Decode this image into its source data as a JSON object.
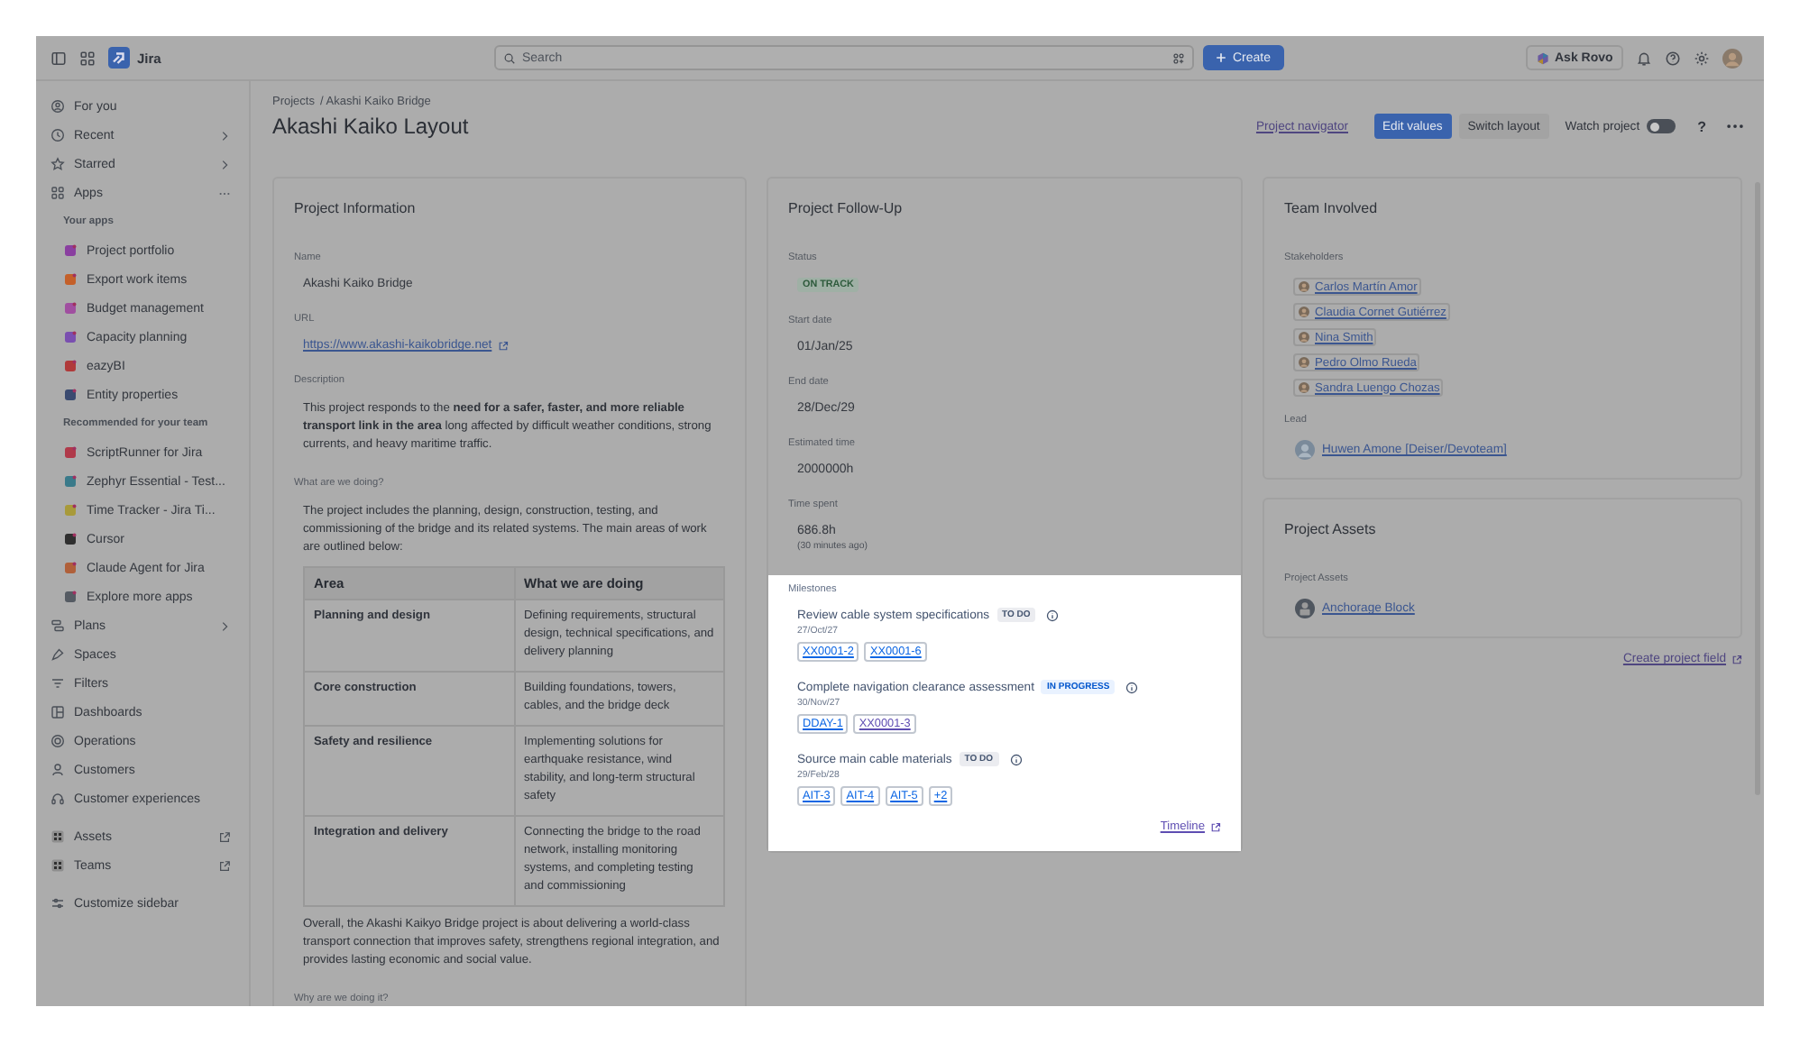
{
  "topbar": {
    "product": "Jira",
    "search": {
      "placeholder": "Search"
    },
    "create_button": "Create",
    "ask_rovo_button": "Ask Rovo"
  },
  "sidebar": {
    "sections": [
      {
        "items": [
          {
            "label": "For you",
            "kind": "nav"
          },
          {
            "label": "Recent",
            "kind": "menu"
          },
          {
            "label": "Starred",
            "kind": "menu"
          },
          {
            "label": "Apps",
            "kind": "group"
          },
          {
            "label": "Your apps",
            "kind": "heading"
          },
          {
            "label": "Project portfolio",
            "kind": "app"
          },
          {
            "label": "Export work items",
            "kind": "app"
          },
          {
            "label": "Budget management",
            "kind": "app"
          },
          {
            "label": "Capacity planning",
            "kind": "app"
          },
          {
            "label": "eazyBI",
            "kind": "app"
          },
          {
            "label": "Entity properties",
            "kind": "app"
          },
          {
            "label": "Recommended for your team",
            "kind": "heading"
          },
          {
            "label": "ScriptRunner for Jira",
            "kind": "app"
          },
          {
            "label": "Zephyr Essential - Test...",
            "kind": "app"
          },
          {
            "label": "Time Tracker - Jira Ti...",
            "kind": "app"
          },
          {
            "label": "Cursor",
            "kind": "app"
          },
          {
            "label": "Claude Agent for Jira",
            "kind": "app"
          },
          {
            "label": "Explore more apps",
            "kind": "app"
          },
          {
            "label": "Plans",
            "kind": "menu"
          },
          {
            "label": "Spaces",
            "kind": "nav"
          },
          {
            "label": "Filters",
            "kind": "nav"
          },
          {
            "label": "Dashboards",
            "kind": "nav"
          },
          {
            "label": "Operations",
            "kind": "nav"
          },
          {
            "label": "Customers",
            "kind": "nav"
          },
          {
            "label": "Customer experiences",
            "kind": "nav"
          }
        ]
      },
      {
        "items": [
          {
            "label": "Assets",
            "kind": "external"
          },
          {
            "label": "Teams",
            "kind": "external"
          }
        ]
      },
      {
        "items": [
          {
            "label": "Customize sidebar",
            "kind": "nav"
          }
        ]
      }
    ]
  },
  "breadcrumbs": [
    "Projects",
    "/ Akashi Kaiko Bridge"
  ],
  "page_title": "Akashi Kaiko Layout",
  "actions": {
    "project_navigator": "Project navigator",
    "edit_values": "Edit values",
    "switch_layout": "Switch layout",
    "watch_project": {
      "label": "Watch project",
      "on": false
    },
    "help": "?"
  },
  "project_information": {
    "title": "Project Information",
    "fields": [
      {
        "label": "Name",
        "kind": "text",
        "value": "Akashi Kaiko Bridge"
      },
      {
        "label": "URL",
        "kind": "link",
        "value": "https://www.akashi-kaikobridge.net"
      },
      {
        "label": "Description",
        "kind": "content",
        "blocks": [
          {
            "kind": "paragraph",
            "text": "This project responds to the **need for a safer, faster, and more reliable transport link in the area** long affected by difficult weather conditions, strong currents, and heavy maritime traffic."
          }
        ]
      },
      {
        "label": "What are we doing?",
        "kind": "content",
        "blocks": [
          {
            "kind": "paragraph",
            "text": "The project includes the planning, design, construction, testing, and commissioning of the bridge and its related systems. The main areas of work are outlined below:"
          },
          {
            "kind": "table",
            "columns": [
              "Area",
              "What we are doing"
            ],
            "rows": [
              [
                "Planning and design",
                "Defining requirements, structural design, technical specifications, and delivery planning"
              ],
              [
                "Core construction",
                "Building foundations, towers, cables, and the bridge deck"
              ],
              [
                "Safety and resilience",
                "Implementing solutions for earthquake resistance, wind stability, and long-term structural safety"
              ],
              [
                "Integration and delivery",
                "Connecting the bridge to the road network, installing monitoring systems, and completing testing and commissioning"
              ]
            ]
          },
          {
            "kind": "paragraph",
            "text": "Overall, the Akashi Kaikyo Bridge project is about delivering a world-class transport connection that improves safety, strengthens regional integration, and provides lasting economic and social value."
          }
        ]
      },
      {
        "label": "Why are we doing it?",
        "kind": "content"
      }
    ]
  },
  "follow_up": {
    "title": "Project Follow-Up",
    "fields": [
      {
        "label": "Status",
        "kind": "status",
        "value": "ON TRACK"
      },
      {
        "label": "Start date",
        "kind": "text",
        "value": "01/Jan/25"
      },
      {
        "label": "End date",
        "kind": "text",
        "value": "28/Dec/29"
      },
      {
        "label": "Estimated time",
        "kind": "text",
        "value": "2000000h"
      },
      {
        "label": "Time spent",
        "kind": "time",
        "value": "686.8h",
        "note": "(30 minutes ago)"
      }
    ],
    "milestones": {
      "label": "Milestones",
      "highlighted": true,
      "items": [
        {
          "title": "Review cable system specifications",
          "status": "TO DO",
          "kind": "todo",
          "date": "27/Oct/27",
          "keys": [
            {
              "label": "XX0001-2",
              "visited": false
            },
            {
              "label": "XX0001-6",
              "visited": false
            }
          ]
        },
        {
          "title": "Complete navigation clearance assessment",
          "status": "IN PROGRESS",
          "kind": "inprogress",
          "date": "30/Nov/27",
          "keys": [
            {
              "label": "DDAY-1",
              "visited": false
            },
            {
              "label": "XX0001-3",
              "visited": true
            }
          ]
        },
        {
          "title": "Source main cable materials",
          "status": "TO DO",
          "kind": "todo",
          "date": "29/Feb/28",
          "keys": [
            {
              "label": "AIT-3",
              "visited": false
            },
            {
              "label": "AIT-4",
              "visited": false
            },
            {
              "label": "AIT-5",
              "visited": false
            },
            {
              "label": "+2",
              "visited": false
            }
          ]
        }
      ],
      "timeline_link": "Timeline"
    }
  },
  "team": {
    "title": "Team Involved",
    "stakeholders_label": "Stakeholders",
    "stakeholders": [
      "Carlos Martín Amor",
      "Claudia Cornet Gutiérrez",
      "Nina Smith",
      "Pedro Olmo Rueda",
      "Sandra Luengo Chozas"
    ],
    "lead_label": "Lead",
    "lead": "Huwen Amone [Deiser/Devoteam]"
  },
  "assets": {
    "title": "Project Assets",
    "label": "Project Assets",
    "items": [
      "Anchorage Block"
    ]
  },
  "create_field_link": "Create project field"
}
